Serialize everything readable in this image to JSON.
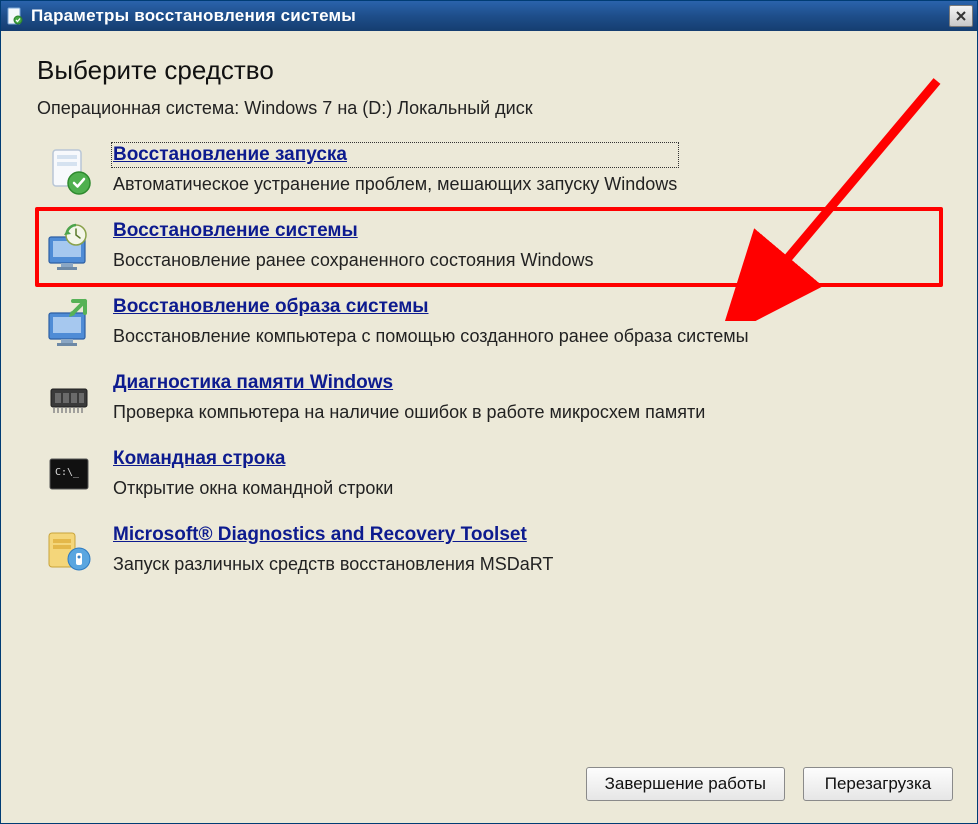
{
  "window": {
    "title": "Параметры восстановления системы"
  },
  "heading": "Выберите средство",
  "subheading": "Операционная система: Windows 7 на (D:) Локальный диск",
  "tools": [
    {
      "title": "Восстановление запуска",
      "desc": "Автоматическое устранение проблем, мешающих запуску Windows"
    },
    {
      "title": "Восстановление системы",
      "desc": "Восстановление ранее сохраненного состояния Windows"
    },
    {
      "title": "Восстановление образа системы",
      "desc": "Восстановление компьютера с помощью  созданного ранее образа системы"
    },
    {
      "title": "Диагностика памяти Windows",
      "desc": "Проверка компьютера на наличие ошибок в работе микросхем памяти"
    },
    {
      "title": "Командная строка",
      "desc": "Открытие окна командной строки"
    },
    {
      "title": "Microsoft® Diagnostics and Recovery Toolset",
      "desc": "Запуск различных средств восстановления MSDaRT"
    }
  ],
  "buttons": {
    "shutdown": "Завершение работы",
    "restart": "Перезагрузка"
  }
}
